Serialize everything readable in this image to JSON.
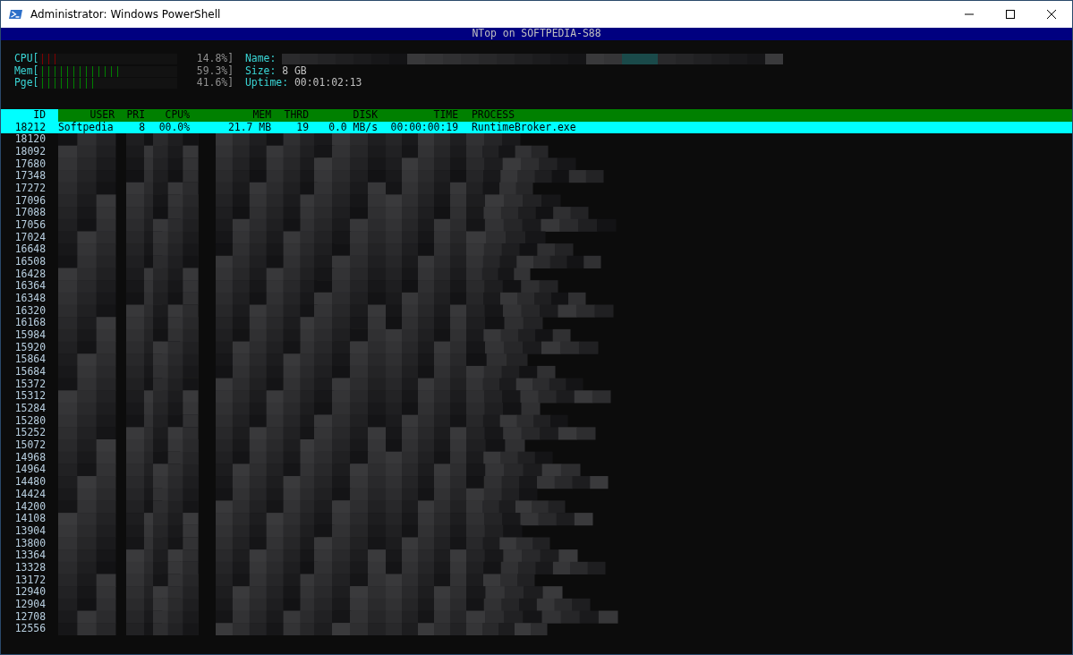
{
  "window": {
    "title": "Administrator: Windows PowerShell"
  },
  "banner": "NTop on SOFTPEDIA-S88",
  "meters": [
    {
      "label": "CPU[",
      "level": 0.148,
      "reading": "14.8%]",
      "color": "#800000"
    },
    {
      "label": "Mem[",
      "level": 0.593,
      "reading": "59.3%]",
      "color": "#008000"
    },
    {
      "label": "Pge[",
      "level": 0.416,
      "reading": "41.6%]",
      "color": "#008000"
    }
  ],
  "info": [
    {
      "label": "Name:"
    },
    {
      "label": "Size:",
      "value": "8 GB"
    },
    {
      "label": "Uptime:",
      "value": "00:01:02:13"
    }
  ],
  "table": {
    "columns": [
      "ID",
      "USER",
      "PRI",
      "CPU%",
      "MEM",
      "THRD",
      "DISK",
      "TIME",
      "PROCESS"
    ],
    "selected_row": {
      "selected": true,
      "cells": [
        "18212",
        "Softpedia",
        "8",
        "00.0%",
        "21.7 MB",
        "19",
        "0.0 MB/s",
        "00:00:00:19",
        "RuntimeBroker.exe"
      ]
    },
    "redacted_rows": [
      "18120",
      "18092",
      "17680",
      "17348",
      "17272",
      "17096",
      "17088",
      "17056",
      "17024",
      "16648",
      "16508",
      "16428",
      "16364",
      "16348",
      "16320",
      "16168",
      "15984",
      "15920",
      "15864",
      "15684",
      "15372",
      "15312",
      "15284",
      "15280",
      "15252",
      "15072",
      "14968",
      "14964",
      "14480",
      "14424",
      "14200",
      "14108",
      "13904",
      "13800",
      "13364",
      "13328",
      "13172",
      "12940",
      "12904",
      "12708",
      "12556"
    ]
  }
}
